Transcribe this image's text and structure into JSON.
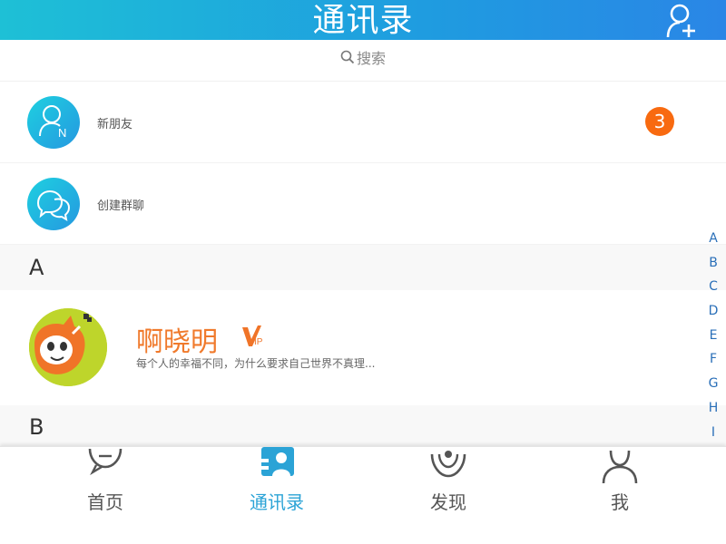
{
  "header": {
    "title": "通讯录",
    "add_icon": "add-user-icon"
  },
  "search": {
    "placeholder": "搜索",
    "icon": "search-icon"
  },
  "functions": [
    {
      "label": "新朋友",
      "icon": "user-n-icon",
      "badge": "3"
    },
    {
      "label": "创建群聊",
      "icon": "group-chat-icon"
    }
  ],
  "sections": [
    {
      "letter": "A",
      "contacts": [
        {
          "name": "啊晓明",
          "vip": "VIP",
          "signature": "每个人的幸福不同，为什么要求自己世界不真理..."
        }
      ]
    },
    {
      "letter": "B",
      "contacts": []
    }
  ],
  "alphabet": [
    "A",
    "B",
    "C",
    "D",
    "E",
    "F",
    "G",
    "H",
    "I"
  ],
  "tabs": [
    {
      "label": "首页",
      "icon": "chat-bubble-icon",
      "active": false
    },
    {
      "label": "通讯录",
      "icon": "contacts-icon",
      "active": true
    },
    {
      "label": "发现",
      "icon": "discover-icon",
      "active": false
    },
    {
      "label": "我",
      "icon": "person-icon",
      "active": false
    }
  ],
  "colors": {
    "header_start": "#1ec0d6",
    "header_end": "#2a86e6",
    "accent": "#2ba3d6",
    "badge": "#f86a10",
    "name": "#f07a2c",
    "index": "#2a6fb8"
  }
}
